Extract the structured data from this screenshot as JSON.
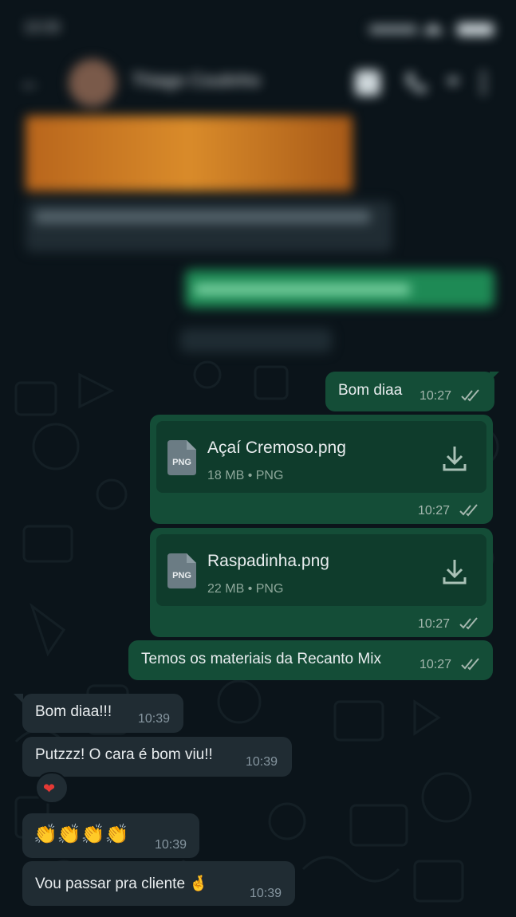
{
  "status_bar": {
    "time": "13:33"
  },
  "header": {
    "contact_name": "Thiago Coutinho"
  },
  "blurred": {
    "caption_text": "Fazer o print do cupom com as três imagens pfv",
    "outgoing_text": "Bom sorte! Tamo junto, avisado!",
    "date_label": "1 de março de 2024"
  },
  "messages": {
    "m1": {
      "text": "Bom diaa",
      "time": "10:27"
    },
    "m2": {
      "file_name": "Açaí Cremoso.png",
      "file_meta": "18 MB • PNG",
      "file_type": "PNG",
      "time": "10:27"
    },
    "m3": {
      "file_name": "Raspadinha.png",
      "file_meta": "22 MB • PNG",
      "file_type": "PNG",
      "time": "10:27"
    },
    "m4": {
      "text": "Temos os materiais da Recanto Mix",
      "time": "10:27"
    },
    "m5": {
      "text": "Bom diaa!!!",
      "time": "10:39"
    },
    "m6": {
      "text": "Putzzz! O cara é bom viu!!",
      "time": "10:39",
      "reaction": "❤"
    },
    "m7": {
      "text": "👏👏👏👏",
      "time": "10:39"
    },
    "m8": {
      "text": "Vou passar pra cliente 🤞",
      "time": "10:39"
    }
  },
  "colors": {
    "outgoing": "#144d37",
    "incoming": "#202c33",
    "background": "#0b141a",
    "read_ticks": "#a4b7ae"
  }
}
